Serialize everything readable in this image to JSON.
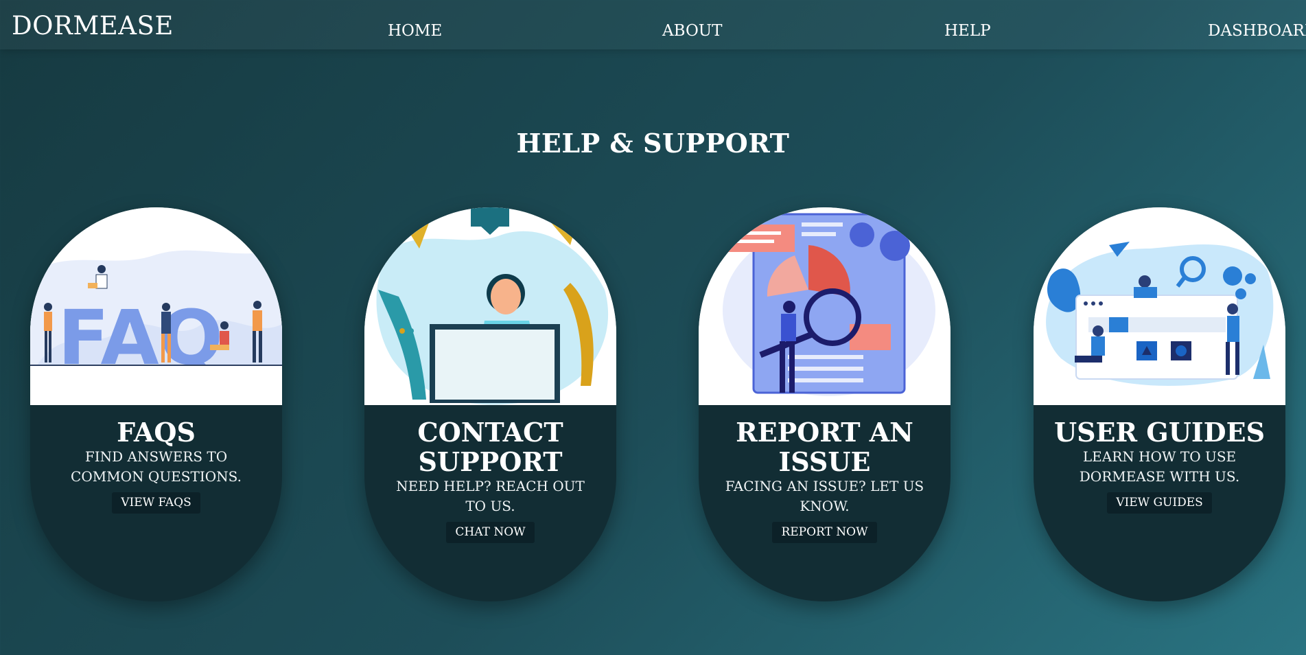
{
  "nav": {
    "brand": "DORMEASE",
    "home": "HOME",
    "about": "ABOUT",
    "help": "HELP",
    "dashboard": "DASHBOARD"
  },
  "page": {
    "title": "HELP & SUPPORT"
  },
  "cards": [
    {
      "title": "FAQS",
      "description": "FIND ANSWERS TO COMMON QUESTIONS.",
      "button": "VIEW FAQS",
      "illustration": "faq-illustration"
    },
    {
      "title": "CONTACT SUPPORT",
      "description": "NEED HELP? REACH OUT TO US.",
      "button": "CHAT NOW",
      "illustration": "support-agent-illustration"
    },
    {
      "title": "REPORT AN ISSUE",
      "description": "FACING AN ISSUE? LET US KNOW.",
      "button": "REPORT NOW",
      "illustration": "report-issue-illustration"
    },
    {
      "title": "USER GUIDES",
      "description": "LEARN HOW TO USE DORMEASE WITH US.",
      "button": "VIEW GUIDES",
      "illustration": "user-guides-illustration"
    }
  ],
  "colors": {
    "background_start": "#163a41",
    "background_end": "#2a7482",
    "card_body": "#122d34",
    "button": "#0c2128"
  }
}
